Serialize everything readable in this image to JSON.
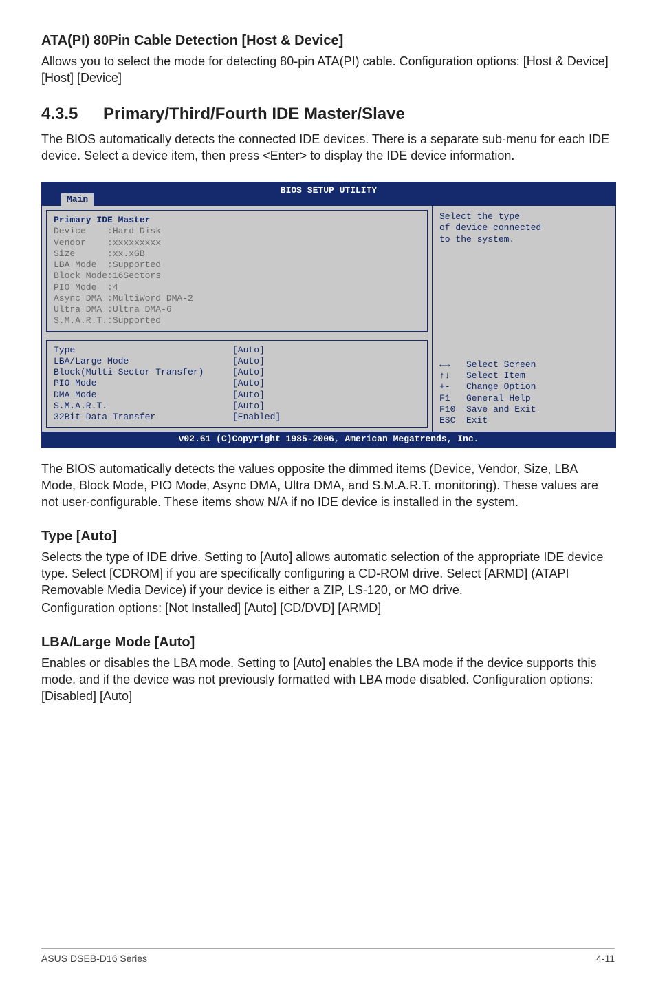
{
  "page": {
    "heading1": "ATA(PI) 80Pin Cable Detection [Host & Device]",
    "para1": "Allows you to select the mode for detecting 80-pin ATA(PI) cable. Configuration options: [Host & Device] [Host] [Device]",
    "section_number": "4.3.5",
    "section_title": "Primary/Third/Fourth IDE Master/Slave",
    "para2": "The BIOS automatically detects the connected IDE devices. There is a separate sub-menu for each IDE device. Select a device item, then press <Enter> to display the IDE device information.",
    "para_after_bios": "The BIOS automatically detects the values opposite the dimmed items (Device, Vendor, Size, LBA Mode, Block Mode, PIO Mode, Async DMA, Ultra DMA, and S.M.A.R.T. monitoring). These values are not user-configurable. These items show N/A if no IDE device is installed in the system.",
    "heading2": "Type [Auto]",
    "para3": "Selects the type of IDE drive. Setting to [Auto] allows automatic selection of the appropriate IDE device type. Select [CDROM] if you are specifically configuring a CD-ROM drive. Select [ARMD] (ATAPI Removable Media Device) if your device is either a ZIP, LS-120, or MO drive.",
    "para3b": "Configuration options: [Not Installed] [Auto] [CD/DVD] [ARMD]",
    "heading3": "LBA/Large Mode [Auto]",
    "para4": "Enables or disables the LBA mode. Setting to [Auto] enables the LBA mode if the device supports this mode, and if the device was not previously formatted with LBA mode disabled. Configuration options: [Disabled] [Auto]",
    "footer_left": "ASUS DSEB-D16 Series",
    "footer_right": "4-11"
  },
  "bios": {
    "title": "BIOS SETUP UTILITY",
    "tab": "Main",
    "section_header": "Primary IDE Master",
    "dimmed_rows": [
      "Device    :Hard Disk",
      "Vendor    :xxxxxxxxx",
      "Size      :xx.xGB",
      "LBA Mode  :Supported",
      "Block Mode:16Sectors",
      "PIO Mode  :4",
      "Async DMA :MultiWord DMA-2",
      "Ultra DMA :Ultra DMA-6",
      "S.M.A.R.T.:Supported"
    ],
    "option_rows": [
      {
        "label": "Type",
        "value": "[Auto]"
      },
      {
        "label": "LBA/Large Mode",
        "value": "[Auto]"
      },
      {
        "label": "Block(Multi-Sector Transfer)",
        "value": "[Auto]"
      },
      {
        "label": "PIO Mode",
        "value": "[Auto]"
      },
      {
        "label": "DMA Mode",
        "value": "[Auto]"
      },
      {
        "label": "S.M.A.R.T.",
        "value": "[Auto]"
      },
      {
        "label": "32Bit Data Transfer",
        "value": "[Enabled]"
      }
    ],
    "help_top": "Select the type\nof device connected\nto the system.",
    "keys": "←→   Select Screen\n↑↓   Select Item\n+-   Change Option\nF1   General Help\nF10  Save and Exit\nESC  Exit",
    "footer": "v02.61 (C)Copyright 1985-2006, American Megatrends, Inc."
  }
}
